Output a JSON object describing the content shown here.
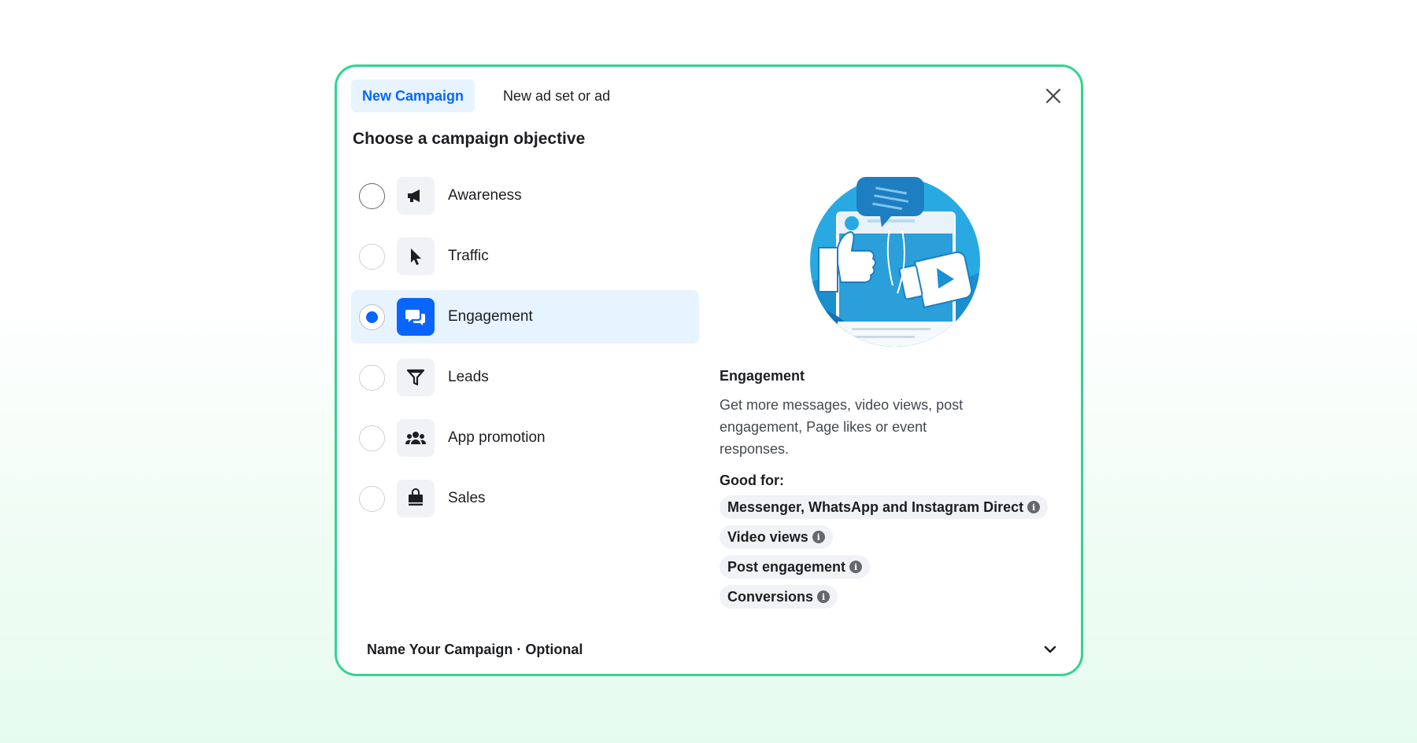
{
  "tabs": [
    {
      "label": "New Campaign",
      "active": true
    },
    {
      "label": "New ad set or ad",
      "active": false
    }
  ],
  "heading": "Choose a campaign objective",
  "objectives": [
    {
      "label": "Awareness",
      "icon": "megaphone-icon",
      "selected": false
    },
    {
      "label": "Traffic",
      "icon": "cursor-icon",
      "selected": false
    },
    {
      "label": "Engagement",
      "icon": "chat-bubbles-icon",
      "selected": true
    },
    {
      "label": "Leads",
      "icon": "funnel-icon",
      "selected": false
    },
    {
      "label": "App promotion",
      "icon": "people-icon",
      "selected": false
    },
    {
      "label": "Sales",
      "icon": "shopping-bag-icon",
      "selected": false
    }
  ],
  "detail": {
    "title": "Engagement",
    "description": "Get more messages, video views, post engagement, Page likes or event responses.",
    "good_for_label": "Good for:",
    "good_for": [
      "Messenger, WhatsApp and Instagram Direct",
      "Video views",
      "Post engagement",
      "Conversions"
    ],
    "info_glyph": "i"
  },
  "footer": {
    "label": "Name Your Campaign · Optional"
  },
  "colors": {
    "accent": "#0866ff",
    "selected_bg": "#e7f3ff",
    "modal_border": "#2fd68e",
    "illustration_blue": "#29a9e1"
  }
}
